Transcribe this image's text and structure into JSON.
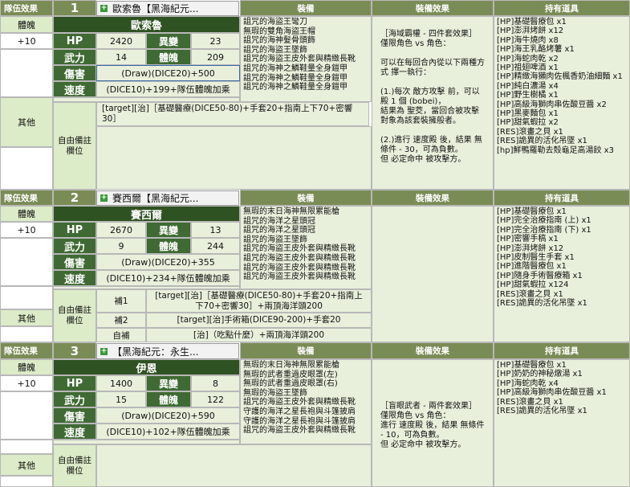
{
  "headers": {
    "team_effect": "隊伍效果",
    "equipment": "裝備",
    "equipment_effect": "裝備效果",
    "items": "持有道具",
    "soul": "體魄",
    "soul_value": "+10",
    "other": "其他",
    "free_note": "自由備註\n欄位",
    "hp": "HP",
    "mutation": "異變",
    "strength": "武力",
    "physique": "體魄",
    "damage": "傷害",
    "speed": "速度"
  },
  "chars": [
    {
      "num": "1",
      "tab": "歐索魯【黑海紀元...",
      "name": "歐索魯",
      "hp": "2420",
      "mutation": "23",
      "strength": "14",
      "physique": "209",
      "damage": "(Draw)(DICE20)+500",
      "speed": "(DICE10)+199+隊伍體魄加乘",
      "equipment": "詛咒的海盜王彎刀\n無瑕的雙角海盜王帽\n詛咒的海神髮骨頭飾\n詛咒的海盜王墜飾\n詛咒的海盜王皮外套與精緻長靴\n詛咒的海神之鱗鞋量全身鎧甲\n詛咒的海神之鱗鞋量全身鎧甲\n詛咒的海神之鱗鞋量全身鎧甲",
      "effect": "［海域霸權 - 四件套效果］\n僅限角色 vs 角色：\n\n可以在每回合內從以下兩種方式 擇一執行：\n\n(1.)每次 敵方攻擊 前，可以殿 1 個 (bobei)，\n結果為 聖茭，當回合被攻擊對象為該套裝擁般者。\n\n(2.)進行 速度殿 後，結果 無條件 - 30，可為負數。\n但 必定命中 被攻擊方。",
      "items": "[HP]基礎醫療包 x1\n[HP]澎湃烤餅 x12\n[HP]海牛燒肉 x8\n[HP]海王乳酪烤薯 x1\n[HP]海蛇肉乾 x2\n[HP]祖翅啤酒 x1\n[HP]精緻海獺肉佐楓香奶油細麵 x1\n[HP]純白濃湯 x4\n[HP]野生樹橘 x1\n[HP]高級海獅肉串佐酸豆醬 x2\n[HP]黑麥麵包 x1\n[HP]甜氣蝦拉 x2\n[RES]滾畫之貝 x1\n[RES]詭異的活化吊墜 x1\n[hp]鮮鴨羅勒去殼龜足高湯餃 x3",
      "note": "[target][治]［基礎醫療(DICE50-80)+手套20+指南上下70+密響30］"
    },
    {
      "num": "2",
      "tab": "賽西爾【黑海紀元...",
      "name": "賽西爾",
      "hp": "2670",
      "mutation": "13",
      "strength": "9",
      "physique": "244",
      "damage": "(Draw)(DICE20)+355",
      "speed": "(DICE10)+234+隊伍體魄加乘",
      "equipment": "無瑕的末日海神無限累能槍\n詛咒的海洋之星頭冠\n詛咒的海洋之星頭冠\n詛咒的海盜王墜飾\n詛咒的海盜王皮外套與精緻長靴\n詛咒的海盜王皮外套與精緻長靴\n詛咒的海盜王皮外套與精緻長靴\n詛咒的海盜王皮外套與精緻長靴",
      "items": "[HP]基礎醫療包 x1\n[HP]完全治療指南 (上) x1\n[HP]完全治療指南 (下) x1\n[HP]密響手稿 x1\n[HP]澎湃烤餅 x12\n[HP]皮制醫生手套 x1\n[HP]進階醫療包 x1\n[HP]隨身手術醫療箱 x1\n[HP]甜氣蝦拉 x124\n[RES]滾畫之貝 x1\n[RES]詭異的活化吊墜 x1",
      "supp1_label": "補1",
      "supp1": "[target][治]［基礎醫療(DICE50-80)+手套20+指南上下70+密響30］+兩頂海洋頭200",
      "supp2_label": "補2",
      "supp2": "[target][治]手術箱(DICE90-200)+手套20",
      "self_label": "自補",
      "self": "[治]（吃點什麼）+兩頂海洋頭200"
    },
    {
      "num": "3",
      "tab": "【黑海紀元：永生...",
      "name": "伊恩",
      "hp": "1400",
      "mutation": "8",
      "strength": "15",
      "physique": "122",
      "damage": "(Draw)(DICE20)+590",
      "speed": "(DICE10)+102+隊伍體魄加乘",
      "equipment": "無瑕的末日海神無限累能槍\n無瑕的武者重過皮眼罩(左)\n無瑕的武者重過皮眼罩(右)\n無瑕的海盜王墜飾\n詛咒的海盜王皮外套與精緻長靴\n守護的海洋之星長袍與斗篷披肩\n守護的海洋之星長袍與斗篷披肩\n詛咒的海盜王皮外套與精緻長靴",
      "effect": "［盲眼武者 - 兩件套效果］\n僅限角色 vs 角色：\n進行 速度殿 後，結果 無條件 - 10，可為負數。\n但 必定命中 被攻擊方。",
      "items": "[HP]基礎醫療包 x1\n[HP]奶奶的神秘燉湯 x1\n[HP]海蛇肉乾 x4\n[HP]高級海獅肉串佐酸豆醬 x1\n[RES]滾畫之貝 x1\n[RES]詭異的活化吊墜 x1"
    }
  ]
}
